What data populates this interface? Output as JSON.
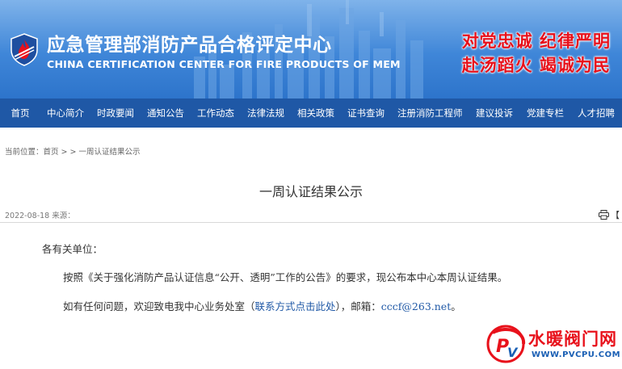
{
  "header": {
    "title_cn": "应急管理部消防产品合格评定中心",
    "title_en": "CHINA CERTIFICATION CENTER FOR FIRE PRODUCTS OF MEM",
    "slogan_line1": "对党忠诚  纪律严明",
    "slogan_line2": "赴汤蹈火  竭诚为民",
    "logo_icon": "shield-flame-icon",
    "slogan_color": "#e8111b"
  },
  "nav": {
    "items": [
      {
        "label": "首页"
      },
      {
        "label": "中心简介"
      },
      {
        "label": "时政要闻"
      },
      {
        "label": "通知公告"
      },
      {
        "label": "工作动态"
      },
      {
        "label": "法律法规"
      },
      {
        "label": "相关政策"
      },
      {
        "label": "证书查询"
      },
      {
        "label": "注册消防工程师"
      },
      {
        "label": "建议投诉"
      },
      {
        "label": "党建专栏"
      },
      {
        "label": "人才招聘"
      }
    ],
    "background": "#1f58a6"
  },
  "breadcrumb": {
    "text": "当前位置：首页 > > 一周认证结果公示"
  },
  "article": {
    "title": "一周认证结果公示",
    "meta": "2022-08-18 来源：",
    "print_label": "【",
    "print_icon": "printer-icon",
    "salutation": "各有关单位：",
    "para1": "按照《关于强化消防产品认证信息“公开、透明”工作的公告》的要求，现公布本中心本周认证结果。",
    "para2_prefix": "如有任何问题，欢迎致电我中心业务处室（",
    "para2_link": "联系方式点击此处",
    "para2_middle": "），邮箱：",
    "para2_email": "cccf@263.net",
    "para2_suffix": "。"
  },
  "watermark": {
    "text": "水暖阀门网",
    "url": "WWW.PVCPU.COM",
    "logo_icon": "pv-logo-icon"
  }
}
